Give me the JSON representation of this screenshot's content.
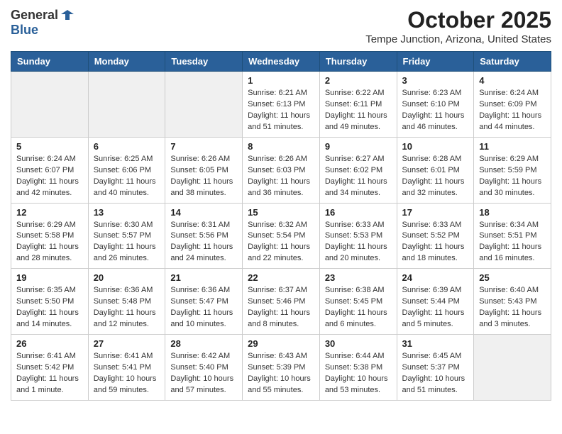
{
  "app": {
    "logo_general": "General",
    "logo_blue": "Blue",
    "title": "October 2025",
    "subtitle": "Tempe Junction, Arizona, United States"
  },
  "calendar": {
    "headers": [
      "Sunday",
      "Monday",
      "Tuesday",
      "Wednesday",
      "Thursday",
      "Friday",
      "Saturday"
    ],
    "weeks": [
      [
        {
          "day": "",
          "info": ""
        },
        {
          "day": "",
          "info": ""
        },
        {
          "day": "",
          "info": ""
        },
        {
          "day": "1",
          "info": "Sunrise: 6:21 AM\nSunset: 6:13 PM\nDaylight: 11 hours\nand 51 minutes."
        },
        {
          "day": "2",
          "info": "Sunrise: 6:22 AM\nSunset: 6:11 PM\nDaylight: 11 hours\nand 49 minutes."
        },
        {
          "day": "3",
          "info": "Sunrise: 6:23 AM\nSunset: 6:10 PM\nDaylight: 11 hours\nand 46 minutes."
        },
        {
          "day": "4",
          "info": "Sunrise: 6:24 AM\nSunset: 6:09 PM\nDaylight: 11 hours\nand 44 minutes."
        }
      ],
      [
        {
          "day": "5",
          "info": "Sunrise: 6:24 AM\nSunset: 6:07 PM\nDaylight: 11 hours\nand 42 minutes."
        },
        {
          "day": "6",
          "info": "Sunrise: 6:25 AM\nSunset: 6:06 PM\nDaylight: 11 hours\nand 40 minutes."
        },
        {
          "day": "7",
          "info": "Sunrise: 6:26 AM\nSunset: 6:05 PM\nDaylight: 11 hours\nand 38 minutes."
        },
        {
          "day": "8",
          "info": "Sunrise: 6:26 AM\nSunset: 6:03 PM\nDaylight: 11 hours\nand 36 minutes."
        },
        {
          "day": "9",
          "info": "Sunrise: 6:27 AM\nSunset: 6:02 PM\nDaylight: 11 hours\nand 34 minutes."
        },
        {
          "day": "10",
          "info": "Sunrise: 6:28 AM\nSunset: 6:01 PM\nDaylight: 11 hours\nand 32 minutes."
        },
        {
          "day": "11",
          "info": "Sunrise: 6:29 AM\nSunset: 5:59 PM\nDaylight: 11 hours\nand 30 minutes."
        }
      ],
      [
        {
          "day": "12",
          "info": "Sunrise: 6:29 AM\nSunset: 5:58 PM\nDaylight: 11 hours\nand 28 minutes."
        },
        {
          "day": "13",
          "info": "Sunrise: 6:30 AM\nSunset: 5:57 PM\nDaylight: 11 hours\nand 26 minutes."
        },
        {
          "day": "14",
          "info": "Sunrise: 6:31 AM\nSunset: 5:56 PM\nDaylight: 11 hours\nand 24 minutes."
        },
        {
          "day": "15",
          "info": "Sunrise: 6:32 AM\nSunset: 5:54 PM\nDaylight: 11 hours\nand 22 minutes."
        },
        {
          "day": "16",
          "info": "Sunrise: 6:33 AM\nSunset: 5:53 PM\nDaylight: 11 hours\nand 20 minutes."
        },
        {
          "day": "17",
          "info": "Sunrise: 6:33 AM\nSunset: 5:52 PM\nDaylight: 11 hours\nand 18 minutes."
        },
        {
          "day": "18",
          "info": "Sunrise: 6:34 AM\nSunset: 5:51 PM\nDaylight: 11 hours\nand 16 minutes."
        }
      ],
      [
        {
          "day": "19",
          "info": "Sunrise: 6:35 AM\nSunset: 5:50 PM\nDaylight: 11 hours\nand 14 minutes."
        },
        {
          "day": "20",
          "info": "Sunrise: 6:36 AM\nSunset: 5:48 PM\nDaylight: 11 hours\nand 12 minutes."
        },
        {
          "day": "21",
          "info": "Sunrise: 6:36 AM\nSunset: 5:47 PM\nDaylight: 11 hours\nand 10 minutes."
        },
        {
          "day": "22",
          "info": "Sunrise: 6:37 AM\nSunset: 5:46 PM\nDaylight: 11 hours\nand 8 minutes."
        },
        {
          "day": "23",
          "info": "Sunrise: 6:38 AM\nSunset: 5:45 PM\nDaylight: 11 hours\nand 6 minutes."
        },
        {
          "day": "24",
          "info": "Sunrise: 6:39 AM\nSunset: 5:44 PM\nDaylight: 11 hours\nand 5 minutes."
        },
        {
          "day": "25",
          "info": "Sunrise: 6:40 AM\nSunset: 5:43 PM\nDaylight: 11 hours\nand 3 minutes."
        }
      ],
      [
        {
          "day": "26",
          "info": "Sunrise: 6:41 AM\nSunset: 5:42 PM\nDaylight: 11 hours\nand 1 minute."
        },
        {
          "day": "27",
          "info": "Sunrise: 6:41 AM\nSunset: 5:41 PM\nDaylight: 10 hours\nand 59 minutes."
        },
        {
          "day": "28",
          "info": "Sunrise: 6:42 AM\nSunset: 5:40 PM\nDaylight: 10 hours\nand 57 minutes."
        },
        {
          "day": "29",
          "info": "Sunrise: 6:43 AM\nSunset: 5:39 PM\nDaylight: 10 hours\nand 55 minutes."
        },
        {
          "day": "30",
          "info": "Sunrise: 6:44 AM\nSunset: 5:38 PM\nDaylight: 10 hours\nand 53 minutes."
        },
        {
          "day": "31",
          "info": "Sunrise: 6:45 AM\nSunset: 5:37 PM\nDaylight: 10 hours\nand 51 minutes."
        },
        {
          "day": "",
          "info": ""
        }
      ]
    ]
  }
}
